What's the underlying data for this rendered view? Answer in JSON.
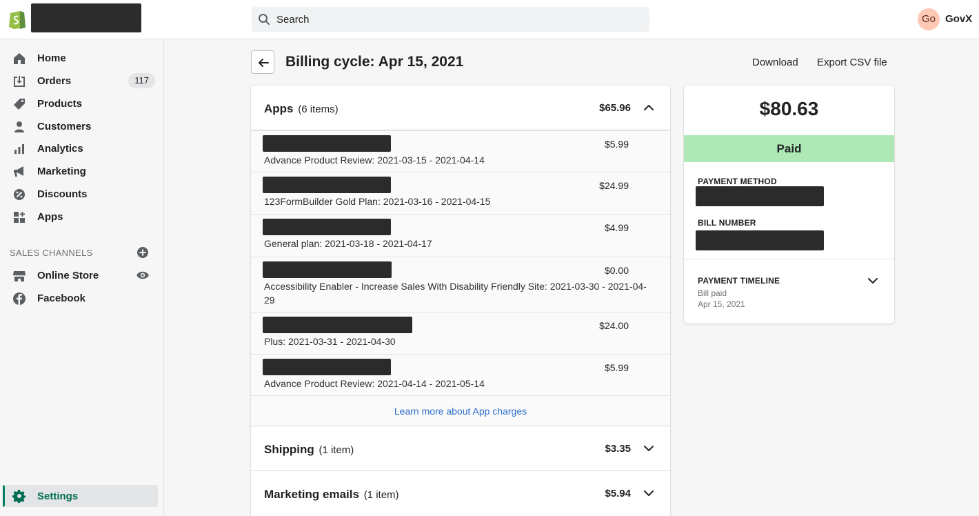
{
  "topbar": {
    "search_placeholder": "Search",
    "avatar_initials": "Go",
    "username": "GovX"
  },
  "sidebar": {
    "items": [
      {
        "label": "Home",
        "icon": "home-icon"
      },
      {
        "label": "Orders",
        "icon": "orders-icon",
        "badge": "117"
      },
      {
        "label": "Products",
        "icon": "tag-icon"
      },
      {
        "label": "Customers",
        "icon": "person-icon"
      },
      {
        "label": "Analytics",
        "icon": "bar-chart-icon"
      },
      {
        "label": "Marketing",
        "icon": "megaphone-icon"
      },
      {
        "label": "Discounts",
        "icon": "discount-icon"
      },
      {
        "label": "Apps",
        "icon": "apps-icon"
      }
    ],
    "sales_channels_label": "SALES CHANNELS",
    "channels": [
      {
        "label": "Online Store",
        "icon": "store-icon"
      },
      {
        "label": "Facebook",
        "icon": "facebook-icon"
      }
    ],
    "settings_label": "Settings"
  },
  "header": {
    "title": "Billing cycle: Apr 15, 2021",
    "download_label": "Download",
    "export_label": "Export CSV file"
  },
  "apps_section": {
    "title": "Apps",
    "count": "(6 items)",
    "amount": "$65.96",
    "items": [
      {
        "description": "Advance Product Review: 2021-03-15 - 2021-04-14",
        "amount": "$5.99"
      },
      {
        "description": "123FormBuilder Gold Plan: 2021-03-16 - 2021-04-15",
        "amount": "$24.99"
      },
      {
        "description": "General plan: 2021-03-18 - 2021-04-17",
        "amount": "$4.99"
      },
      {
        "description": "Accessibility Enabler - Increase Sales With Disability Friendly Site: 2021-03-30 - 2021-04-29",
        "amount": "$0.00"
      },
      {
        "description": "Plus: 2021-03-31 - 2021-04-30",
        "amount": "$24.00"
      },
      {
        "description": "Advance Product Review: 2021-04-14 - 2021-05-14",
        "amount": "$5.99"
      }
    ],
    "learn_more": "Learn more about App charges"
  },
  "shipping_section": {
    "title": "Shipping",
    "count": "(1 item)",
    "amount": "$3.35"
  },
  "marketing_section": {
    "title": "Marketing emails",
    "count": "(1 item)",
    "amount": "$5.94"
  },
  "summary": {
    "total": "$80.63",
    "status": "Paid",
    "status_color": "#aee9b5",
    "payment_method_label": "PAYMENT METHOD",
    "bill_number_label": "BILL NUMBER",
    "timeline_label": "PAYMENT TIMELINE",
    "timeline_event": "Bill paid",
    "timeline_date": "Apr 15, 2021"
  },
  "colors": {
    "brand_green": "#008060",
    "link_blue": "#2c6ecb"
  }
}
